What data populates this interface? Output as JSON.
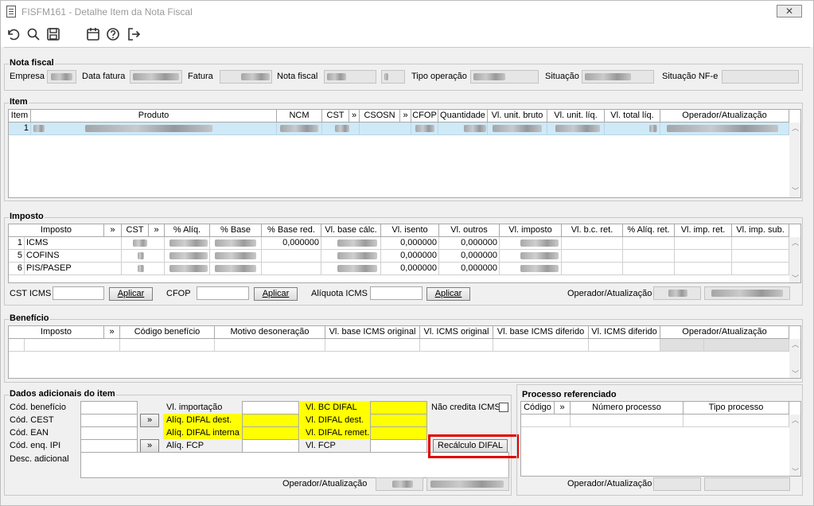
{
  "window": {
    "title": "FISFM161 - Detalhe Item da Nota Fiscal",
    "close_label": "✕"
  },
  "toolbar": {
    "icons": [
      "undo-icon",
      "search-icon",
      "save-icon",
      "calendar-icon",
      "help-icon",
      "exit-icon"
    ]
  },
  "nota_fiscal": {
    "section_title": "Nota fiscal",
    "empresa_label": "Empresa",
    "data_fatura_label": "Data fatura",
    "fatura_label": "Fatura",
    "nota_fiscal_label": "Nota fiscal",
    "tipo_operacao_label": "Tipo operação",
    "situacao_label": "Situação",
    "situacao_nfe_label": "Situação NF-e"
  },
  "item": {
    "section_title": "Item",
    "columns": [
      "Item",
      "Produto",
      "NCM",
      "CST",
      "»",
      "CSOSN",
      "»",
      "CFOP",
      "Quantidade",
      "Vl. unit. bruto",
      "Vl. unit. líq.",
      "Vl. total líq.",
      "Operador/Atualização"
    ],
    "row": {
      "item": "1"
    }
  },
  "imposto": {
    "section_title": "Imposto",
    "columns": [
      "Imposto",
      "»",
      "CST",
      "»",
      "% Alíq.",
      "% Base",
      "% Base red.",
      "Vl. base cálc.",
      "Vl. isento",
      "Vl. outros",
      "Vl. imposto",
      "Vl. b.c. ret.",
      "% Alíq. ret.",
      "Vl. imp. ret.",
      "Vl. imp. sub."
    ],
    "rows": [
      {
        "num": "1",
        "imposto": "ICMS",
        "base_red": "0,000000",
        "isento": "0,000000",
        "outros": "0,000000"
      },
      {
        "num": "5",
        "imposto": "COFINS",
        "base_red": "",
        "isento": "0,000000",
        "outros": "0,000000"
      },
      {
        "num": "6",
        "imposto": "PIS/PASEP",
        "base_red": "",
        "isento": "0,000000",
        "outros": "0,000000"
      }
    ],
    "cst_icms_label": "CST ICMS",
    "cfop_label": "CFOP",
    "aliquota_icms_label": "Alíquota ICMS",
    "aplicar_label": "Aplicar",
    "operador_label": "Operador/Atualização"
  },
  "beneficio": {
    "section_title": "Benefício",
    "columns": [
      "Imposto",
      "»",
      "Código benefício",
      "Motivo desoneração",
      "Vl. base ICMS original",
      "Vl. ICMS original",
      "Vl. base ICMS diferido",
      "Vl. ICMS diferido",
      "Operador/Atualização"
    ]
  },
  "dados_adicionais": {
    "section_title": "Dados adicionais do item",
    "cod_beneficio_label": "Cód. benefício",
    "cod_cest_label": "Cód. CEST",
    "cod_ean_label": "Cód. EAN",
    "cod_enq_ipi_label": "Cód. enq. IPI",
    "desc_adicional_label": "Desc. adicional",
    "vl_importacao_label": "Vl. importação",
    "aliq_difal_dest_label": "Alíq. DIFAL dest.",
    "aliq_difal_interna_label": "Alíq. DIFAL interna",
    "aliq_fcp_label": "Alíq. FCP",
    "vl_bc_difal_label": "Vl. BC DIFAL",
    "vl_difal_dest_label": "Vl. DIFAL dest.",
    "vl_difal_remet_label": "Vl. DIFAL remet.",
    "vl_fcp_label": "Vl. FCP",
    "nao_credita_icms_label": "Não credita ICMS",
    "recalculo_difal_label": "Recálculo DIFAL",
    "operador_label": "Operador/Atualização",
    "highlight_color": "#ffff00",
    "callout_color": "#e00000"
  },
  "processo": {
    "section_title": "Processo referenciado",
    "columns": [
      "Código",
      "»",
      "Número processo",
      "Tipo processo"
    ],
    "operador_label": "Operador/Atualização"
  }
}
